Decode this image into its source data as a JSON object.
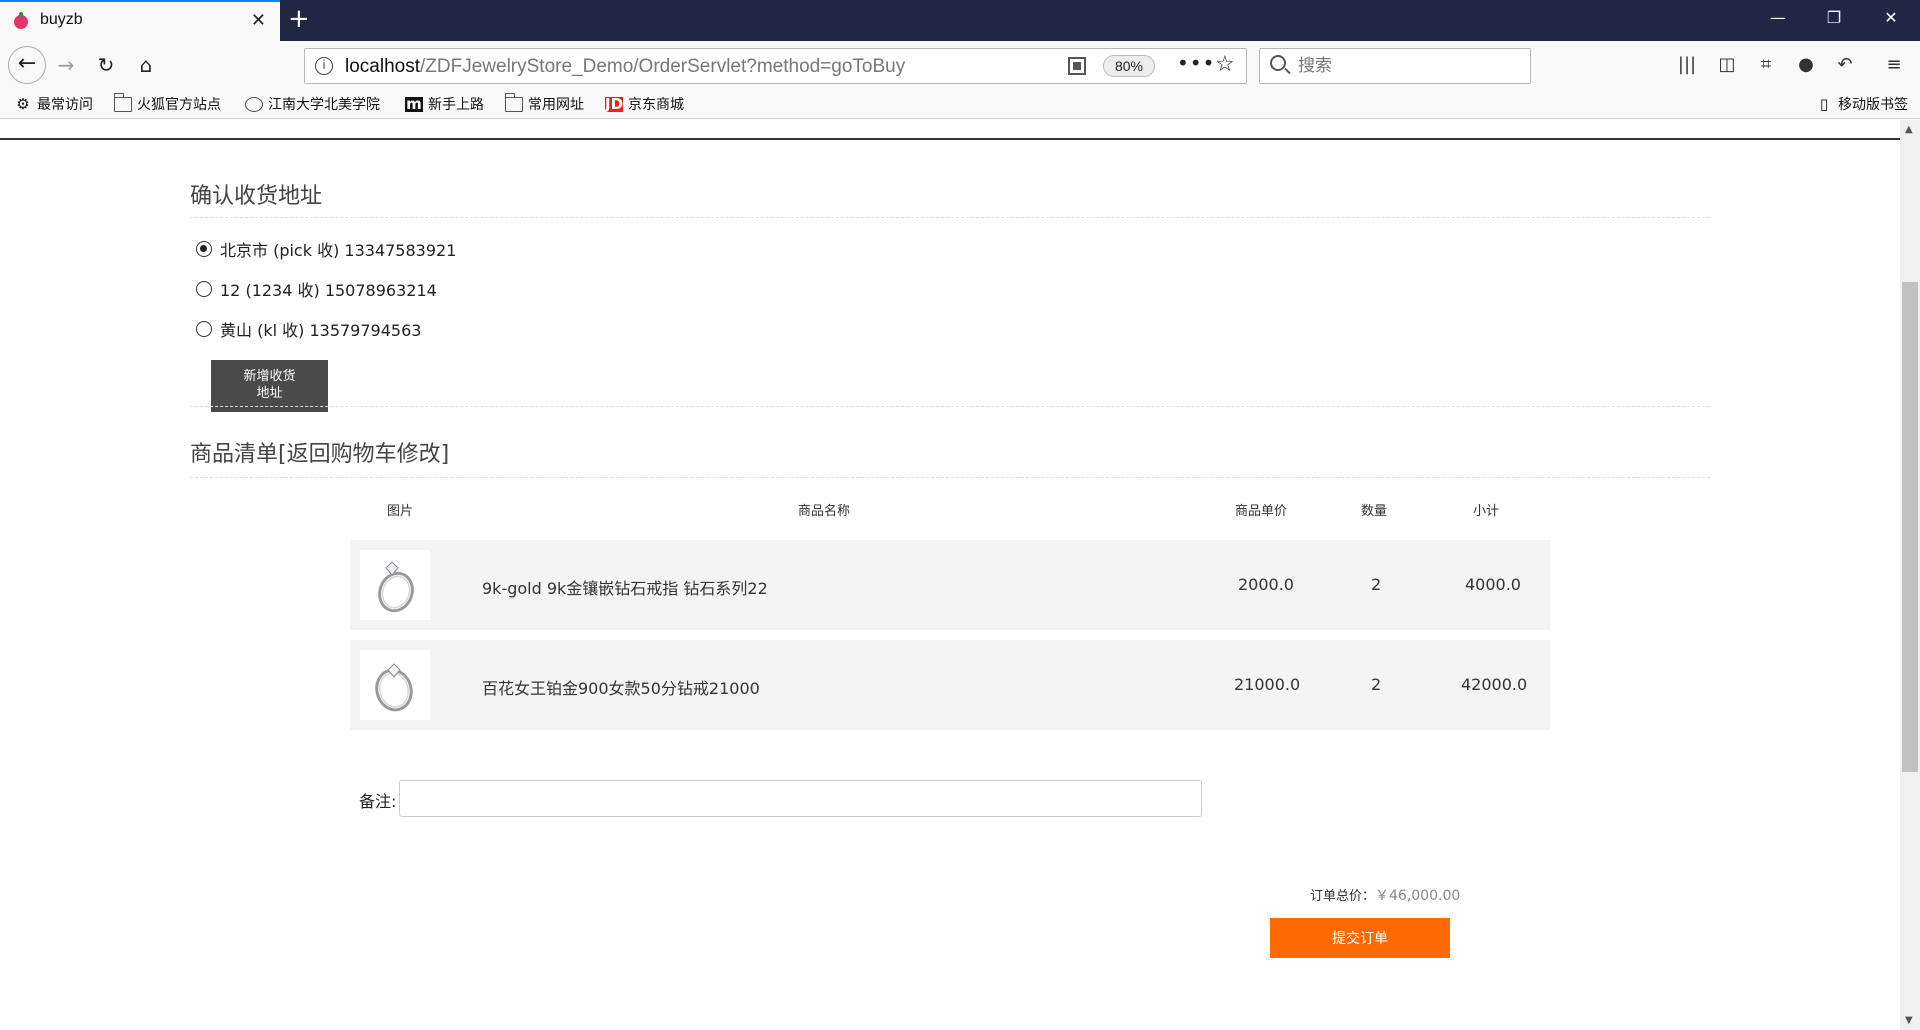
{
  "browser": {
    "tab_title": "buyzb",
    "url_host": "localhost",
    "url_path": "/ZDFJewelryStore_Demo/OrderServlet?method=goToBuy",
    "zoom": "80%",
    "search_placeholder": "搜索",
    "bookmarks": [
      "最常访问",
      "火狐官方站点",
      "江南大学北美学院",
      "新手上路",
      "常用网址",
      "京东商城"
    ],
    "mobile_bookmarks": "移动版书签"
  },
  "address_section": {
    "title": "确认收货地址",
    "addresses": [
      {
        "text": "北京市 (pick 收) 13347583921",
        "selected": true
      },
      {
        "text": "12 (1234 收) 15078963214",
        "selected": false
      },
      {
        "text": "黄山 (kl 收) 13579794563",
        "selected": false
      }
    ],
    "add_button_line1": "新增收货",
    "add_button_line2": "地址"
  },
  "items_section": {
    "title": "商品清单[返回购物车修改]",
    "headers": {
      "image": "图片",
      "name": "商品名称",
      "price": "商品单价",
      "qty": "数量",
      "subtotal": "小计"
    },
    "items": [
      {
        "name": "9k-gold 9k金镶嵌钻石戒指 钻石系列22",
        "price": "2000.0",
        "qty": "2",
        "subtotal": "4000.0",
        "image_icon": "ring-icon"
      },
      {
        "name": "百花女王铂金900女款50分钻戒21000",
        "price": "21000.0",
        "qty": "2",
        "subtotal": "42000.0",
        "image_icon": "ring-icon"
      }
    ]
  },
  "remark": {
    "label": "备注:",
    "value": ""
  },
  "order": {
    "total_label": "订单总价：",
    "total_value": "￥46,000.00",
    "submit_label": "提交订单"
  },
  "colors": {
    "accent": "#ff6a00",
    "dark_button": "#4a4a4a",
    "tab_bar": "#1f2744"
  }
}
